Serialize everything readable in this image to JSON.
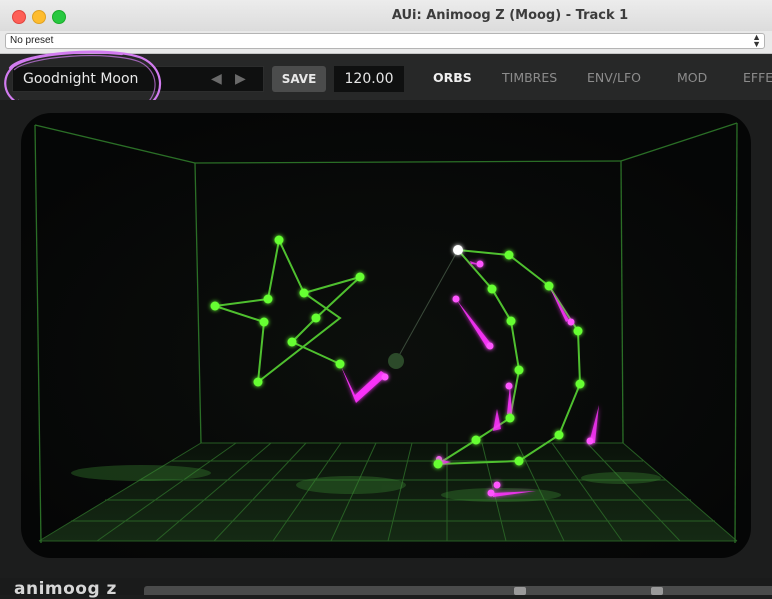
{
  "window": {
    "title": "AUi: Animoog Z (Moog) - Track 1"
  },
  "preset_bar": {
    "selected": "No preset"
  },
  "toolbar": {
    "preset_name": "Goodnight Moon",
    "prev_glyph": "◀",
    "next_glyph": "▶",
    "save_label": "SAVE",
    "tempo": "120.00",
    "tabs": [
      {
        "label": "ORBS",
        "active": true
      },
      {
        "label": "TIMBRES",
        "active": false
      },
      {
        "label": "ENV/LFO",
        "active": false
      },
      {
        "label": "MOD",
        "active": false
      },
      {
        "label": "EFFEC",
        "active": false
      }
    ]
  },
  "footer": {
    "logo": "animoog z"
  },
  "colors": {
    "orb_green": "#66ff33",
    "trail_magenta": "#ff33ff",
    "grid_green": "#2f7a2a",
    "annotation": "#d27cf0"
  }
}
